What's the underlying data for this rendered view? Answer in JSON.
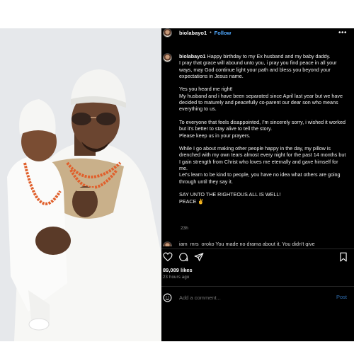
{
  "post": {
    "username": "biolabayo1",
    "separator": "•",
    "follow_label": "Follow",
    "more_icon": "more-horizontal-icon",
    "caption": {
      "username": "biolabayo1",
      "text": " Happy birthday to my Ex husband and my baby daddy.\nI pray that grace will abound unto you, i pray you find peace in all your ways, may God continue light your path and bless you beyond your expectations in Jesus name.\n\nYes you heard me right!\nMy husband and i have been separated since April last year but we have decided to maturely and peacefully co-parent our dear son who means everything to us.\n\nTo everyone that feels disappointed, I'm sincerely sorry, i wished it worked but it's better to stay alive to tell the story.\nPlease keep us in your prayers.\n\nWhile I go about making other people happy in the day, my pillow is drenched with my own tears almost every night for the past 14 months but I gain strength from Christ who loves me eternally and gave himself for me.\nLet's learn to be kind to people, you have no idea what others are going through until they say it.\n\nSAY UNTO THE RIGHTEOUS ALL IS WELL!\nPEACE ✌"
    },
    "caption_time": "23h",
    "next_comment_preview": "iam_mrs_oroko  You made no drama about it. You didn't give",
    "likes": "89,089 likes",
    "posted_ago": "23 hours ago",
    "comment_placeholder": "Add a comment...",
    "post_button": "Post",
    "icons": [
      "heart-icon",
      "comment-icon",
      "share-icon",
      "bookmark-icon",
      "emoji-icon"
    ]
  }
}
